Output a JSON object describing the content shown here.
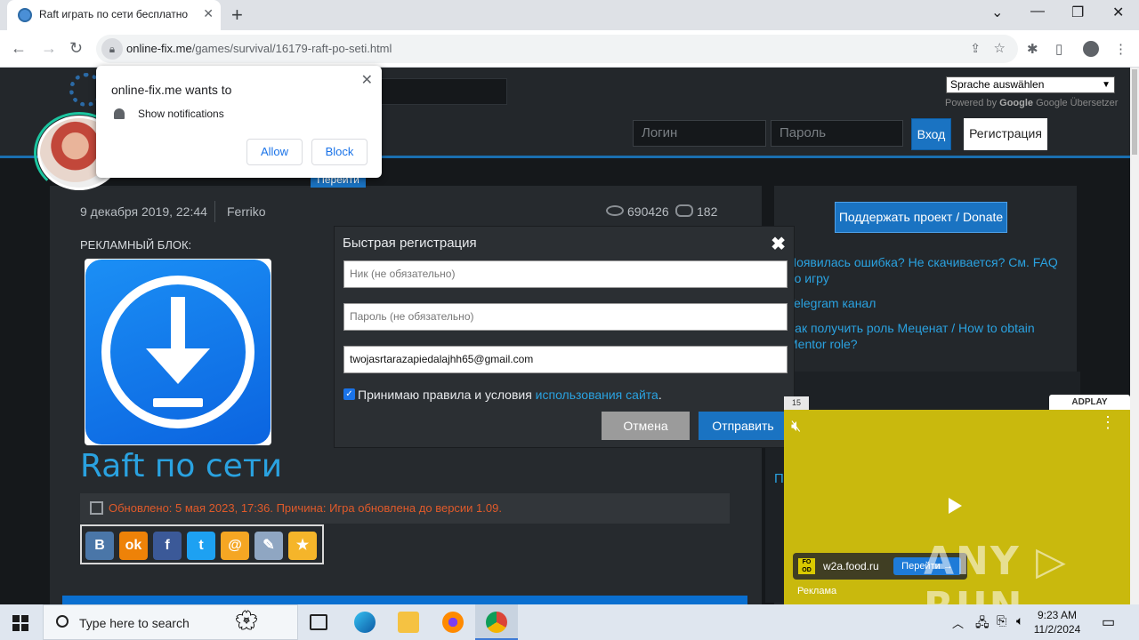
{
  "browser": {
    "tab_title": "Raft играть по сети бесплатно",
    "url_domain": "online-fix.me",
    "url_path": "/games/survival/16179-raft-po-seti.html"
  },
  "header": {
    "lang_select": "Sprache auswählen",
    "powered_by": "Powered by",
    "google": "Google",
    "translate": "Google Übersetzer",
    "login_placeholder": "Логин",
    "password_placeholder": "Пароль",
    "login_button": "Вход",
    "register_button": "Регистрация"
  },
  "notification": {
    "title": "online-fix.me wants to",
    "text": "Show notifications",
    "allow": "Allow",
    "block": "Block",
    "behind_button": "Перейти"
  },
  "article": {
    "date": "9 декабря 2019, 22:44",
    "author": "Ferriko",
    "views": "690426",
    "comments": "182",
    "ad_label": "РЕКЛАМНЫЙ БЛОК:",
    "title": "Raft по сети",
    "update": "Обновлено: 5 мая 2023, 17:36. Причина: Игра обновлена до версии 1.09."
  },
  "share": {
    "buttons": [
      {
        "label": "B",
        "color": "#4a76a8"
      },
      {
        "label": "ok",
        "color": "#ee8208"
      },
      {
        "label": "f",
        "color": "#3b5998"
      },
      {
        "label": "t",
        "color": "#1da1f2"
      },
      {
        "label": "@",
        "color": "#f5a623"
      },
      {
        "label": "✎",
        "color": "#8fa6c2"
      },
      {
        "label": "★",
        "color": "#f5b52a"
      }
    ]
  },
  "sidebar": {
    "donate": "Поддержать проект / Donate",
    "link1": "Появилась ошибка? Не скачивается? См. FAQ по игру",
    "link2": "Telegram канал",
    "link3": "Как получить роль Меценат / How to obtain Mentor role?",
    "section_title": "П"
  },
  "modal": {
    "title": "Быстрая регистрация",
    "nick_placeholder": "Ник (не обязательно)",
    "password_placeholder": "Пароль (не обязательно)",
    "email_value": "twojasrtarazapiedalajhh65@gmail.com",
    "terms_text": "Принимаю правила и условия",
    "terms_link": "использования сайта",
    "cancel": "Отмена",
    "submit": "Отправить"
  },
  "video_ad": {
    "counter": "15",
    "brand": "ADPLAY",
    "domain": "w2a.food.ru",
    "go": "Перейти →",
    "label": "Реклама",
    "watermark": "ANY ▷ RUN"
  },
  "taskbar": {
    "search_placeholder": "Type here to search",
    "time": "9:23 AM",
    "date": "11/2/2024"
  },
  "colors": {
    "accent": "#1a73c2",
    "link": "#2aa2e0",
    "update": "#e05a2a",
    "ad_bg": "#c9b90d"
  }
}
